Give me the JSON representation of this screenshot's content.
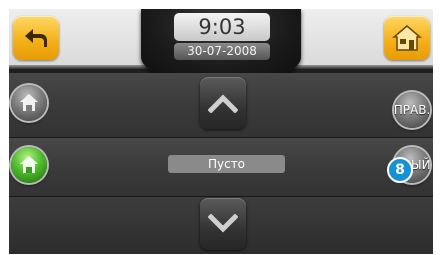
{
  "header": {
    "time": "9:03",
    "date": "30-07-2008"
  },
  "nav": {
    "back_icon": "back-arrow-icon",
    "home_icon": "home-icon"
  },
  "list": {
    "empty_label": "Пусто"
  },
  "right_buttons": {
    "edit_label": "ПРАВ.",
    "new_label": "ОВЫЙ",
    "badge_number": "8"
  },
  "colors": {
    "accent_orange": "#f5b21a",
    "active_green": "#4dbb2a",
    "badge_blue": "#1591d8"
  }
}
